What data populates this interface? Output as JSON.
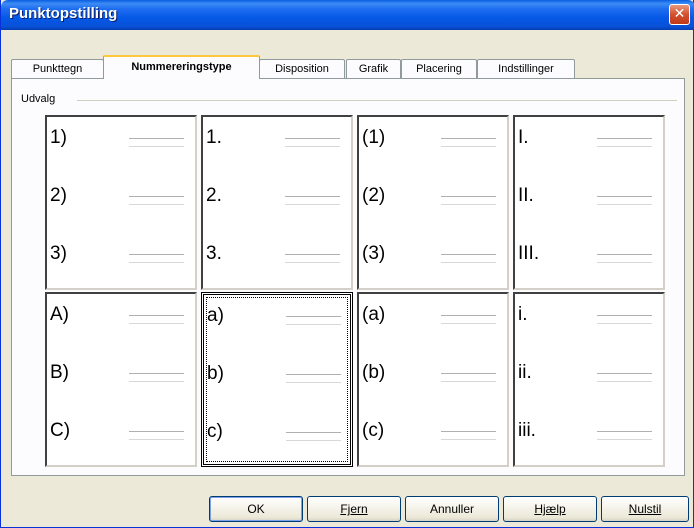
{
  "window": {
    "title": "Punktopstilling",
    "close_glyph": "✕"
  },
  "tabs": [
    {
      "label": "Punkttegn",
      "active": false
    },
    {
      "label": "Nummereringstype",
      "active": true
    },
    {
      "label": "Disposition",
      "active": false
    },
    {
      "label": "Grafik",
      "active": false
    },
    {
      "label": "Placering",
      "active": false
    },
    {
      "label": "Indstillinger",
      "active": false
    }
  ],
  "group": {
    "label": "Udvalg"
  },
  "styles": [
    {
      "items": [
        "1)",
        "2)",
        "3)"
      ],
      "selected": false
    },
    {
      "items": [
        "1.",
        "2.",
        "3."
      ],
      "selected": false
    },
    {
      "items": [
        "(1)",
        "(2)",
        "(3)"
      ],
      "selected": false
    },
    {
      "items": [
        "I.",
        "II.",
        "III."
      ],
      "selected": false
    },
    {
      "items": [
        "A)",
        "B)",
        "C)"
      ],
      "selected": false
    },
    {
      "items": [
        "a)",
        "b)",
        "c)"
      ],
      "selected": true
    },
    {
      "items": [
        "(a)",
        "(b)",
        "(c)"
      ],
      "selected": false
    },
    {
      "items": [
        "i.",
        "ii.",
        "iii."
      ],
      "selected": false
    }
  ],
  "buttons": {
    "ok": "OK",
    "remove": "Fjern",
    "cancel": "Annuller",
    "help": "Hjælp",
    "reset": "Nulstil"
  }
}
